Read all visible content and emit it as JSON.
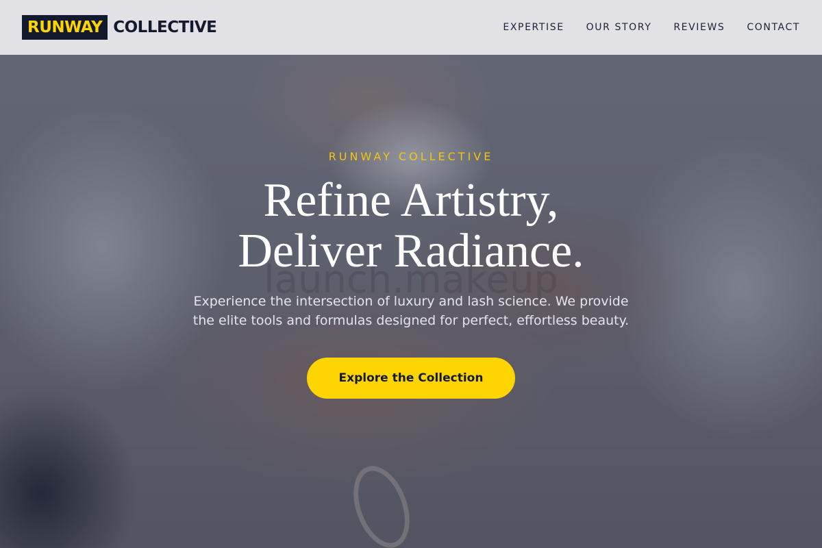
{
  "header": {
    "logo_mark": "RUNWAY",
    "logo_word": "COLLECTIVE",
    "nav": [
      {
        "label": "EXPERTISE"
      },
      {
        "label": "OUR STORY"
      },
      {
        "label": "REVIEWS"
      },
      {
        "label": "CONTACT"
      }
    ]
  },
  "hero": {
    "eyebrow": "RUNWAY COLLECTIVE",
    "headline_line1": "Refine Artistry,",
    "headline_line2": "Deliver Radiance.",
    "watermark": "launch.makeup",
    "subtext_line1": "Experience the intersection of luxury and lash science. We provide",
    "subtext_line2": "the elite tools and formulas designed for perfect, effortless beauty.",
    "cta_label": "Explore the Collection"
  },
  "colors": {
    "accent": "#ffd500",
    "navy": "#141a2e"
  }
}
